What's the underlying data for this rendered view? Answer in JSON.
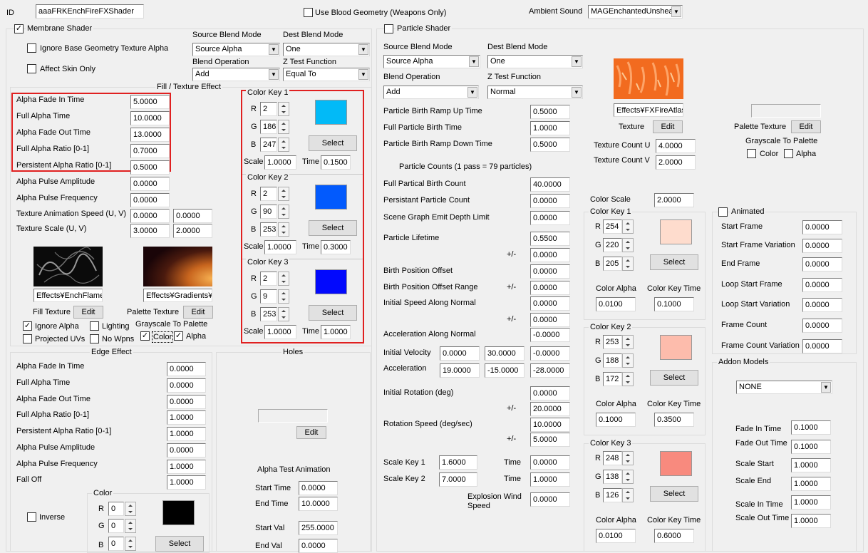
{
  "header": {
    "id_label": "ID",
    "id_value": "aaaFRKEnchFireFXShader",
    "blood_label": "Use Blood Geometry (Weapons Only)",
    "ambient_label": "Ambient Sound",
    "ambient_value": "MAGEnchantedUnsheat"
  },
  "membrane": {
    "title": "Membrane Shader",
    "ignore_base_alpha": "Ignore Base Geometry Texture Alpha",
    "affect_skin": "Affect Skin Only",
    "src_blend_label": "Source Blend Mode",
    "src_blend_value": "Source Alpha",
    "dest_blend_label": "Dest Blend Mode",
    "dest_blend_value": "One",
    "blend_op_label": "Blend Operation",
    "blend_op_value": "Add",
    "ztest_label": "Z Test Function",
    "ztest_value": "Equal To"
  },
  "fill": {
    "title": "Fill / Texture Effect",
    "rows": [
      {
        "label": "Alpha Fade In Time",
        "value": "5.0000"
      },
      {
        "label": "Full Alpha Time",
        "value": "10.0000"
      },
      {
        "label": "Alpha Fade Out Time",
        "value": "13.0000"
      },
      {
        "label": "Full Alpha Ratio [0-1]",
        "value": "0.7000"
      },
      {
        "label": "Persistent Alpha Ratio [0-1]",
        "value": "0.5000"
      },
      {
        "label": "Alpha Pulse Amplitude",
        "value": "0.0000"
      },
      {
        "label": "Alpha Pulse Frequency",
        "value": "0.0000"
      }
    ],
    "tex_anim_label": "Texture Animation Speed (U, V)",
    "tex_anim_u": "0.0000",
    "tex_anim_v": "0.0000",
    "tex_scale_label": "Texture Scale (U, V)",
    "tex_scale_u": "3.0000",
    "tex_scale_v": "2.0000",
    "fill_tex_path": "Effects¥EnchFlameI",
    "palette_tex_path": "Effects¥Gradients¥",
    "fill_tex_label": "Fill Texture",
    "palette_tex_label": "Palette Texture",
    "edit": "Edit",
    "ignore_alpha": "Ignore Alpha",
    "lighting": "Lighting",
    "grayscale_label": "Grayscale To Palette",
    "projected_uvs": "Projected UVs",
    "no_wpns": "No Wpns",
    "color": "Color",
    "alpha": "Alpha"
  },
  "membrane_keys": [
    {
      "title": "Color Key 1",
      "r": "2",
      "g": "186",
      "b": "247",
      "scale": "1.0000",
      "time": "0.1500",
      "color": "#02baf7"
    },
    {
      "title": "Color Key 2",
      "r": "2",
      "g": "90",
      "b": "253",
      "scale": "1.0000",
      "time": "0.3000",
      "color": "#025afd"
    },
    {
      "title": "Color Key 3",
      "r": "2",
      "g": "9",
      "b": "253",
      "scale": "1.0000",
      "time": "1.0000",
      "color": "#0209fd"
    }
  ],
  "key_labels": {
    "r": "R",
    "g": "G",
    "b": "B",
    "scale": "Scale",
    "time": "Time",
    "select": "Select",
    "alpha": "Color Alpha",
    "keytime": "Color Key Time"
  },
  "edge": {
    "title": "Edge Effect",
    "rows": [
      {
        "label": "Alpha Fade In Time",
        "value": "0.0000"
      },
      {
        "label": "Full Alpha Time",
        "value": "0.0000"
      },
      {
        "label": "Alpha Fade Out Time",
        "value": "0.0000"
      },
      {
        "label": "Full Alpha Ratio [0-1]",
        "value": "1.0000"
      },
      {
        "label": "Persistent Alpha Ratio [0-1]",
        "value": "1.0000"
      },
      {
        "label": "Alpha Pulse Amplitude",
        "value": "0.0000"
      },
      {
        "label": "Alpha Pulse Frequency",
        "value": "1.0000"
      },
      {
        "label": "Fall Off",
        "value": "1.0000"
      }
    ],
    "color_title": "Color",
    "inverse": "Inverse",
    "r": "0",
    "g": "0",
    "b": "0",
    "color": "#000000"
  },
  "holes": {
    "title": "Holes",
    "edit": "Edit",
    "anim_title": "Alpha Test Animation",
    "rows": [
      {
        "label": "Start Time",
        "value": "0.0000"
      },
      {
        "label": "End Time",
        "value": "10.0000"
      },
      {
        "label": "Start Val",
        "value": "255.0000"
      },
      {
        "label": "End Val",
        "value": "0.0000"
      }
    ]
  },
  "particle": {
    "title": "Particle Shader",
    "src_blend_label": "Source Blend Mode",
    "src_blend_value": "Source Alpha",
    "dest_blend_label": "Dest Blend Mode",
    "dest_blend_value": "One",
    "blend_op_label": "Blend Operation",
    "blend_op_value": "Add",
    "ztest_label": "Z Test Function",
    "ztest_value": "Normal",
    "rows": [
      {
        "label": "Particle Birth Ramp Up Time",
        "value": "0.5000"
      },
      {
        "label": "Full Particle Birth Time",
        "value": "1.0000"
      },
      {
        "label": "Particle Birth Ramp Down Time",
        "value": "0.5000"
      }
    ],
    "counts_label": "Particle Counts (1 pass = 79 particles)",
    "rows2": [
      {
        "label": "Full Partical Birth Count",
        "value": "40.0000"
      },
      {
        "label": "Persistant Particle Count",
        "value": "0.0000"
      },
      {
        "label": "Scene Graph Emit Depth Limit",
        "value": "0.0000"
      },
      {
        "label": "Particle Lifetime",
        "value": "0.5500"
      }
    ],
    "pm": "+/-",
    "lifetime_var": "0.0000",
    "birth_offset_label": "Birth Position Offset",
    "birth_offset": "0.0000",
    "birth_range_label": "Birth Position Offset Range",
    "birth_range": "0.0000",
    "init_speed_label": "Initial Speed Along Normal",
    "init_speed": "0.0000",
    "init_speed_var": "0.0000",
    "accel_normal_label": "Acceleration Along Normal",
    "accel_normal": "-0.0000",
    "init_vel_label": "Initial Velocity",
    "init_vel": [
      "0.0000",
      "30.0000",
      "-0.0000"
    ],
    "accel_label": "Acceleration",
    "accel": [
      "19.0000",
      "-15.0000",
      "-28.0000"
    ],
    "init_rot_label": "Initial Rotation (deg)",
    "init_rot": "0.0000",
    "init_rot_var": "20.0000",
    "rot_speed_label": "Rotation Speed (deg/sec)",
    "rot_speed": "10.0000",
    "rot_speed_var": "5.0000",
    "scale_key1_label": "Scale Key 1",
    "scale_key1": "1.6000",
    "scale_key1_time": "0.0000",
    "scale_key2_label": "Scale Key 2",
    "scale_key2": "7.0000",
    "scale_key2_time": "1.0000",
    "time_label": "Time",
    "wind_label": "Explosion Wind Speed",
    "wind": "0.0000",
    "tex_path": "Effects¥FXFireAtlas",
    "tex_label": "Texture",
    "edit": "Edit",
    "palette_label": "Palette Texture",
    "count_u_label": "Texture Count U",
    "count_u": "4.0000",
    "count_v_label": "Texture Count V",
    "count_v": "2.0000",
    "grayscale_label": "Grayscale To Palette",
    "color": "Color",
    "alpha": "Alpha",
    "color_scale_label": "Color Scale",
    "color_scale": "2.0000"
  },
  "particle_keys": [
    {
      "title": "Color Key 1",
      "r": "254",
      "g": "220",
      "b": "205",
      "alpha": "0.0100",
      "time": "0.1000",
      "color": "#fedccd"
    },
    {
      "title": "Color Key 2",
      "r": "253",
      "g": "188",
      "b": "172",
      "alpha": "0.1000",
      "time": "0.3500",
      "color": "#fdbcac"
    },
    {
      "title": "Color Key 3",
      "r": "248",
      "g": "138",
      "b": "126",
      "alpha": "0.0100",
      "time": "0.6000",
      "color": "#f88a7e"
    }
  ],
  "animated": {
    "title": "Animated",
    "rows": [
      {
        "label": "Start Frame",
        "value": "0.0000"
      },
      {
        "label": "Start Frame Variation",
        "value": "0.0000"
      },
      {
        "label": "End Frame",
        "value": "0.0000"
      },
      {
        "label": "Loop Start Frame",
        "value": "0.0000"
      },
      {
        "label": "Loop Start Variation",
        "value": "0.0000"
      },
      {
        "label": "Frame Count",
        "value": "0.0000"
      },
      {
        "label": "Frame Count Variation",
        "value": "0.0000"
      }
    ]
  },
  "addon": {
    "title": "Addon Models",
    "model": "NONE",
    "rows": [
      {
        "label": "Fade In Time",
        "value": "0.1000"
      },
      {
        "label": "Fade Out Time",
        "value": "0.1000"
      },
      {
        "label": "Scale Start",
        "value": "1.0000"
      },
      {
        "label": "Scale End",
        "value": "1.0000"
      },
      {
        "label": "Scale In Time",
        "value": "1.0000"
      },
      {
        "label": "Scale Out Time",
        "value": "1.0000"
      }
    ]
  }
}
